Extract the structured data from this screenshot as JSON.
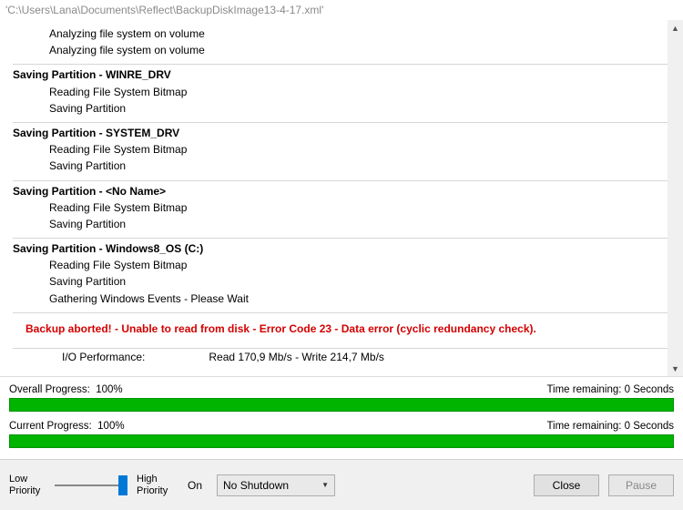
{
  "title": "'C:\\Users\\Lana\\Documents\\Reflect\\BackupDiskImage13-4-17.xml'",
  "log": {
    "analyzing1": "Analyzing file system on volume",
    "analyzing2": "Analyzing file system on volume",
    "part1": {
      "header": "Saving Partition - WINRE_DRV",
      "l1": "Reading File System Bitmap",
      "l2": "Saving Partition"
    },
    "part2": {
      "header": "Saving Partition - SYSTEM_DRV",
      "l1": "Reading File System Bitmap",
      "l2": "Saving Partition"
    },
    "part3": {
      "header": "Saving Partition - <No Name>",
      "l1": "Reading File System Bitmap",
      "l2": "Saving Partition"
    },
    "part4": {
      "header": "Saving Partition - Windows8_OS (C:)",
      "l1": "Reading File System Bitmap",
      "l2": "Saving Partition",
      "l3": "Gathering Windows Events - Please Wait"
    },
    "error": "Backup aborted! - Unable to read from disk - Error Code 23 - Data error (cyclic redundancy check).",
    "io_label": "I/O Performance:",
    "io_value": "Read 170,9 Mb/s - Write 214,7 Mb/s"
  },
  "progress": {
    "overall_label": "Overall Progress:",
    "overall_pct": "100%",
    "overall_time": "Time remaining:  0 Seconds",
    "current_label": "Current Progress:",
    "current_pct": "100%",
    "current_time": "Time remaining:  0 Seconds"
  },
  "footer": {
    "low": "Low Priority",
    "high": "High Priority",
    "on": "On",
    "shutdown_selected": "No Shutdown",
    "close": "Close",
    "pause": "Pause"
  }
}
